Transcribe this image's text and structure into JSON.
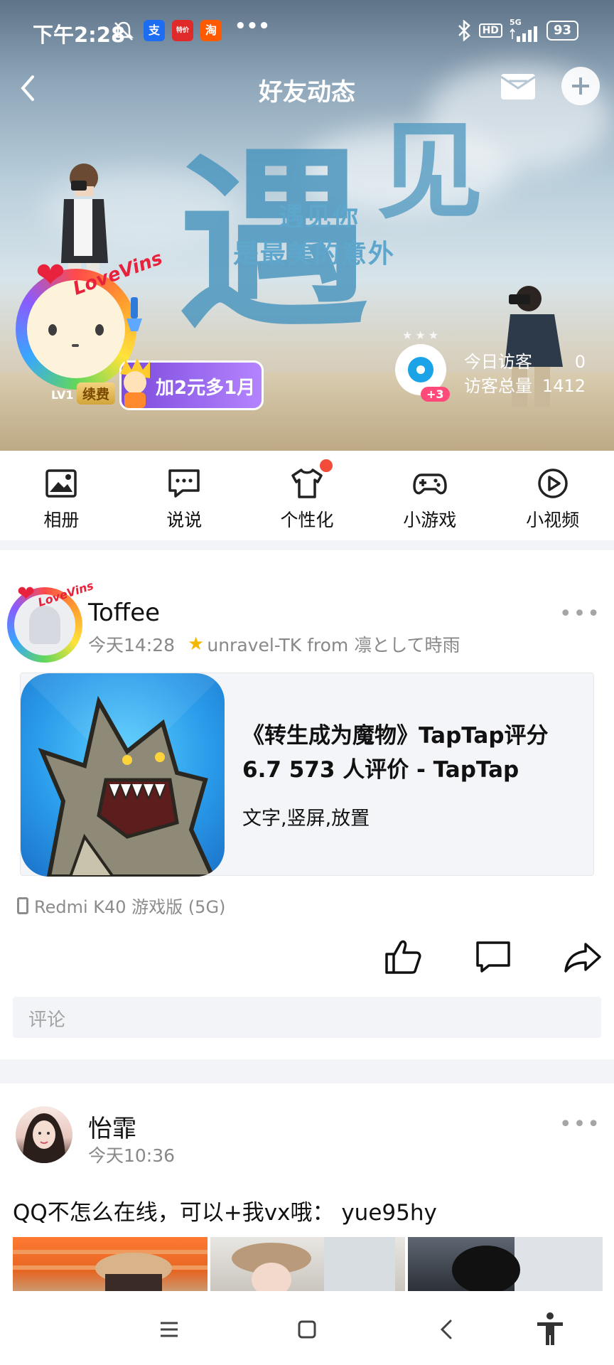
{
  "status_bar": {
    "time": "下午2:28",
    "notif_apps": [
      "支",
      "特价",
      "淘"
    ],
    "more": "•••",
    "hd": "HD",
    "signal": "5G",
    "battery": "93"
  },
  "header": {
    "title": "好友动态"
  },
  "cover": {
    "big_chars": [
      "遇",
      "见"
    ],
    "line1": "遇见你",
    "line2": "是最美的意外"
  },
  "profile": {
    "love_text": "LoveVins",
    "level": "LV1",
    "renew": "续费",
    "promo": "加2元多1月",
    "visitor_badge": "+3",
    "today_label": "今日访客",
    "today_value": "0",
    "total_label": "访客总量",
    "total_value": "1412"
  },
  "quick_menu": [
    {
      "label": "相册",
      "icon": "album-icon"
    },
    {
      "label": "说说",
      "icon": "shuoshuo-icon"
    },
    {
      "label": "个性化",
      "icon": "tshirt-icon"
    },
    {
      "label": "小游戏",
      "icon": "gamepad-icon"
    },
    {
      "label": "小视频",
      "icon": "video-icon"
    }
  ],
  "posts": [
    {
      "author": "Toffee",
      "time": "今天14:28",
      "source": "unravel-TK from 凛として時雨",
      "link": {
        "title": "《转生成为魔物》TapTap评分6.7 573 人评价 - TapTap",
        "tags": "文字,竖屏,放置"
      },
      "device": "Redmi K40 游戏版 (5G)",
      "comment_placeholder": "评论"
    },
    {
      "author": "怡霏",
      "time": "今天10:36",
      "text": "QQ不怎么在线，可以+我vx哦：   yue95hy"
    }
  ],
  "colors": {
    "accent_blue": "#1aa3e6",
    "red_dot": "#f24b3a",
    "promo_purple": "#8a5bff"
  }
}
